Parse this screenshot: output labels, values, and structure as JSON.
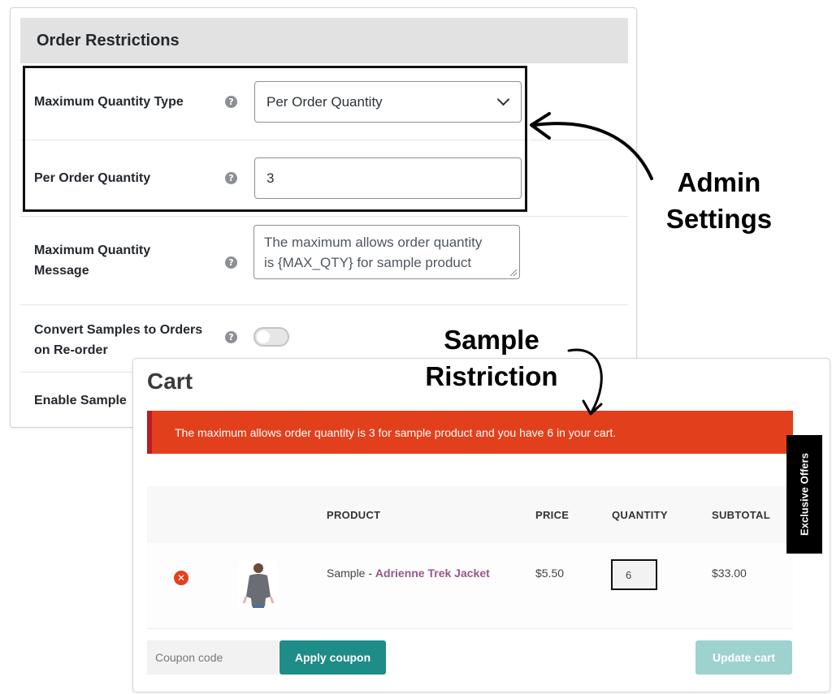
{
  "admin": {
    "section_title": "Order Restrictions",
    "rows": [
      {
        "label": "Maximum Quantity Type",
        "help": "?",
        "value": "Per Order Quantity"
      },
      {
        "label": "Per Order Quantity",
        "help": "?",
        "value": "3"
      },
      {
        "label_line1": "Maximum Quantity",
        "label_line2": "Message",
        "help": "?",
        "value_line1": "The maximum allows order quantity",
        "value_line2": "is {MAX_QTY} for sample product"
      },
      {
        "label_line1": "Convert Samples to Orders",
        "label_line2": "on Re-order",
        "help": "?",
        "toggle_on": false
      },
      {
        "label": "Enable Sample"
      }
    ]
  },
  "annotations": {
    "admin_line1": "Admin",
    "admin_line2": "Settings",
    "sample_line1": "Sample",
    "sample_line2": "Ristriction"
  },
  "cart": {
    "title": "Cart",
    "error_message": "The maximum allows order quantity is 3 for sample product and you have 6 in your cart.",
    "headers": {
      "product": "PRODUCT",
      "price": "PRICE",
      "quantity": "QUANTITY",
      "subtotal": "SUBTOTAL"
    },
    "item": {
      "remove_symbol": "✕",
      "name_prefix": "Sample - ",
      "name_link": "Adrienne Trek Jacket",
      "price": "$5.50",
      "quantity": "6",
      "subtotal": "$33.00"
    },
    "coupon_placeholder": "Coupon code",
    "apply_label": "Apply coupon",
    "update_label": "Update cart",
    "side_tab": "Exclusive Offers"
  },
  "colors": {
    "error_bg": "#e2401c",
    "accent_teal": "#1e8c87",
    "link_purple": "#96588a"
  }
}
